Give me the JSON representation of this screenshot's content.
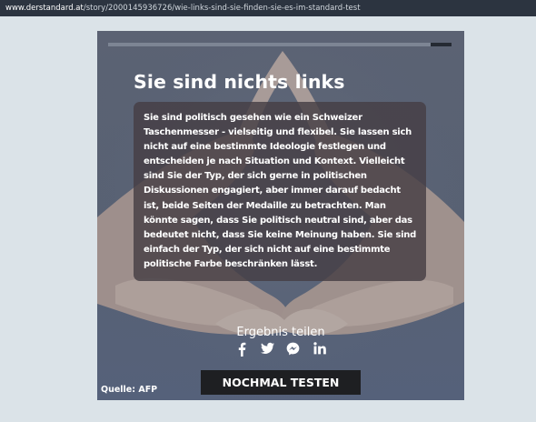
{
  "browser": {
    "url_domain": "www.derstandard.at",
    "url_path": "/story/2000145936726/wie-links-sind-sie-finden-sie-es-im-standard-test"
  },
  "quiz": {
    "progress": 0.94,
    "result_title": "Sie sind nichts links",
    "result_text": "Sie sind politisch gesehen wie ein Schweizer Taschenmesser - vielseitig und flexibel. Sie lassen sich nicht auf eine bestimmte Ideologie festlegen und entscheiden je nach Situation und Kontext. Vielleicht sind Sie der Typ, der sich gerne in politischen Diskussionen engagiert, aber immer darauf bedacht ist, beide Seiten der Medaille zu betrachten. Man könnte sagen, dass Sie politisch neutral sind, aber das bedeutet nicht, dass Sie keine Meinung haben. Sie sind einfach der Typ, der sich nicht auf eine bestimmte politische Farbe beschränken lässt.",
    "share_label": "Ergebnis teilen",
    "share_icons": [
      "facebook-icon",
      "twitter-icon",
      "messenger-icon",
      "linkedin-icon"
    ],
    "retry_label": "NOCHMAL TESTEN",
    "image_credit": "Quelle: AFP"
  },
  "colors": {
    "card_background": "#5d6778",
    "result_box": "#463e44",
    "button_background": "#1e1f22",
    "progress_track": "#252a33",
    "progress_fill": "#7d8594"
  }
}
